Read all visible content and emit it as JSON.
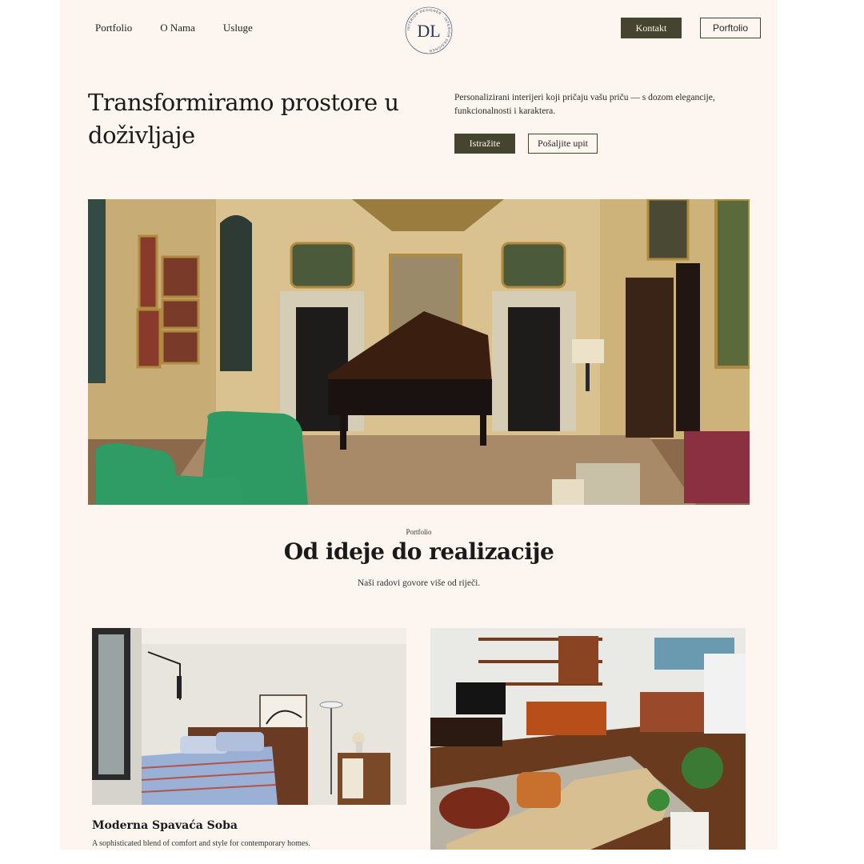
{
  "nav": {
    "links": [
      "Portfolio",
      "O Nama",
      "Usluge"
    ],
    "logo_text": "INTERIOR DESIGNER",
    "logo_monogram": "DL",
    "contact_label": "Kontakt",
    "portfolio_label": "Porftolio"
  },
  "hero": {
    "title": "Transformiramo prostore u doživljaje",
    "description": "Personalizirani interijeri koji pričaju vašu priču — s dozom elegancije, funkcionalnosti i karaktera.",
    "primary_cta": "Istražite",
    "secondary_cta": "Pošaljite upit",
    "image_alt": "Klasični salon s klavirom i zelenim foteljama"
  },
  "portfolio": {
    "eyebrow": "Portfolio",
    "title": "Od ideje do realizacije",
    "subtitle": "Naši radovi govore više od riječi.",
    "cards": [
      {
        "title": "Moderna Spavaća Soba",
        "description": "A sophisticated blend of comfort and style for contemporary homes."
      },
      {
        "title": "",
        "description": ""
      }
    ]
  },
  "colors": {
    "page_bg": "#fdf5ef",
    "accent_dark": "#44442f",
    "text": "#1a1a1a"
  }
}
